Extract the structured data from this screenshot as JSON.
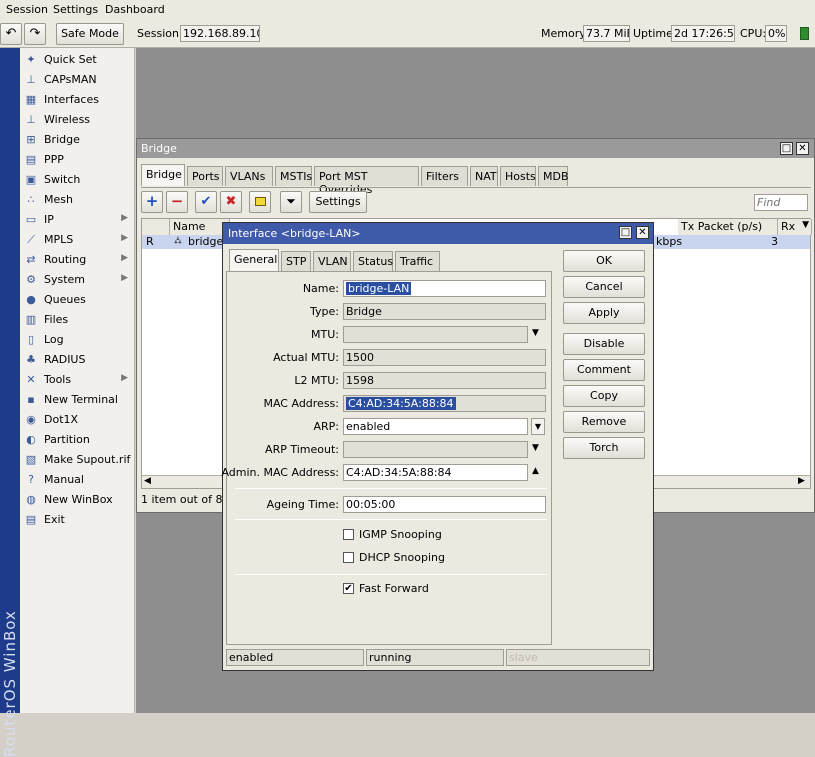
{
  "menu": [
    "Session",
    "Settings",
    "Dashboard"
  ],
  "toolbar": {
    "safe_mode": "Safe Mode",
    "session_label": "Session:",
    "session_value": "192.168.89.100",
    "memory_label": "Memory:",
    "memory_value": "73.7 MiB",
    "uptime_label": "Uptime:",
    "uptime_value": "2d 17:26:51",
    "cpu_label": "CPU:",
    "cpu_value": "0%"
  },
  "brand": "RouterOS WinBox",
  "sidebar": [
    {
      "label": "Quick Set",
      "icon": "wand-icon",
      "glyph": "✦"
    },
    {
      "label": "CAPsMAN",
      "icon": "antenna-icon",
      "glyph": "⊥"
    },
    {
      "label": "Interfaces",
      "icon": "interfaces-icon",
      "glyph": "▦"
    },
    {
      "label": "Wireless",
      "icon": "wireless-icon",
      "glyph": "⊥"
    },
    {
      "label": "Bridge",
      "icon": "bridge-icon",
      "glyph": "⊞"
    },
    {
      "label": "PPP",
      "icon": "ppp-icon",
      "glyph": "▤"
    },
    {
      "label": "Switch",
      "icon": "switch-icon",
      "glyph": "▣"
    },
    {
      "label": "Mesh",
      "icon": "mesh-icon",
      "glyph": "∴"
    },
    {
      "label": "IP",
      "icon": "ip-icon",
      "glyph": "▭",
      "arrow": true
    },
    {
      "label": "MPLS",
      "icon": "mpls-icon",
      "glyph": "⟋",
      "arrow": true
    },
    {
      "label": "Routing",
      "icon": "routing-icon",
      "glyph": "⇄",
      "arrow": true
    },
    {
      "label": "System",
      "icon": "system-icon",
      "glyph": "⚙",
      "arrow": true
    },
    {
      "label": "Queues",
      "icon": "queues-icon",
      "glyph": "●"
    },
    {
      "label": "Files",
      "icon": "files-icon",
      "glyph": "▥"
    },
    {
      "label": "Log",
      "icon": "log-icon",
      "glyph": "▯"
    },
    {
      "label": "RADIUS",
      "icon": "radius-icon",
      "glyph": "♣"
    },
    {
      "label": "Tools",
      "icon": "tools-icon",
      "glyph": "✕",
      "arrow": true
    },
    {
      "label": "New Terminal",
      "icon": "terminal-icon",
      "glyph": "▪"
    },
    {
      "label": "Dot1X",
      "icon": "dot1x-icon",
      "glyph": "◉"
    },
    {
      "label": "Partition",
      "icon": "partition-icon",
      "glyph": "◐"
    },
    {
      "label": "Make Supout.rif",
      "icon": "supout-icon",
      "glyph": "▧"
    },
    {
      "label": "Manual",
      "icon": "manual-icon",
      "glyph": "?"
    },
    {
      "label": "New WinBox",
      "icon": "winbox-icon",
      "glyph": "◍"
    },
    {
      "label": "Exit",
      "icon": "exit-icon",
      "glyph": "▤"
    }
  ],
  "bridge": {
    "title": "Bridge",
    "tabs": [
      "Bridge",
      "Ports",
      "VLANs",
      "MSTIs",
      "Port MST Overrides",
      "Filters",
      "NAT",
      "Hosts",
      "MDB"
    ],
    "settings_button": "Settings",
    "find_placeholder": "Find",
    "columns": [
      "Name",
      "Tx Packet (p/s)",
      "Rx"
    ],
    "row": {
      "flag": "R",
      "name": "bridge-",
      "tx_rate_tail": "kbps",
      "tx_packets": "3"
    },
    "footer": "1 item out of 8 ("
  },
  "dialog": {
    "title": "Interface <bridge-LAN>",
    "tabs": [
      "General",
      "STP",
      "VLAN",
      "Status",
      "Traffic"
    ],
    "fields": {
      "name_label": "Name:",
      "name": "bridge-LAN",
      "type_label": "Type:",
      "type": "Bridge",
      "mtu_label": "MTU:",
      "mtu": "",
      "actual_mtu_label": "Actual MTU:",
      "actual_mtu": "1500",
      "l2mtu_label": "L2 MTU:",
      "l2mtu": "1598",
      "mac_label": "MAC Address:",
      "mac": "C4:AD:34:5A:88:84",
      "arp_label": "ARP:",
      "arp": "enabled",
      "arp_timeout_label": "ARP Timeout:",
      "arp_timeout": "",
      "admin_mac_label": "Admin. MAC Address:",
      "admin_mac": "C4:AD:34:5A:88:84",
      "ageing_label": "Ageing Time:",
      "ageing": "00:05:00"
    },
    "checkboxes": [
      {
        "label": "IGMP Snooping",
        "checked": false
      },
      {
        "label": "DHCP Snooping",
        "checked": false
      },
      {
        "label": "Fast Forward",
        "checked": true
      }
    ],
    "buttons": [
      "OK",
      "Cancel",
      "Apply",
      "Disable",
      "Comment",
      "Copy",
      "Remove",
      "Torch"
    ],
    "status": [
      "enabled",
      "running",
      "slave"
    ]
  },
  "colors": {
    "brand_bg": "#1e3a8a",
    "dialog_title": "#3f5aa8",
    "selected_row": "#c9d5ee",
    "status_green": "#2e8b2e"
  }
}
